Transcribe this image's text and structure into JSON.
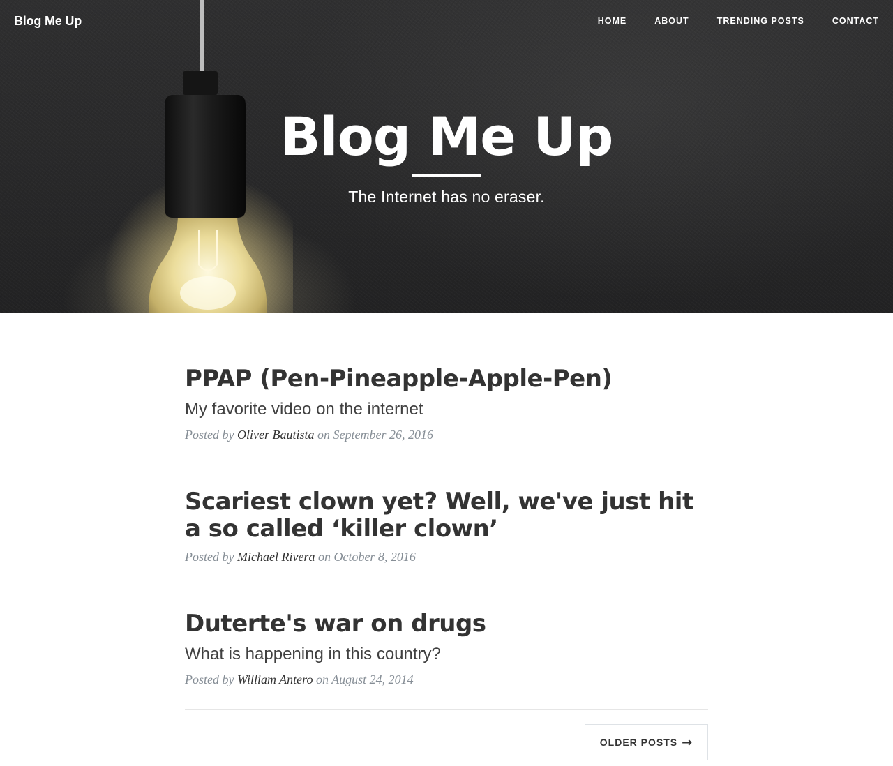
{
  "navbar": {
    "brand": "Blog Me Up",
    "links": [
      {
        "label": "HOME"
      },
      {
        "label": "ABOUT"
      },
      {
        "label": "TRENDING POSTS"
      },
      {
        "label": "CONTACT"
      }
    ]
  },
  "hero": {
    "title": "Blog Me Up",
    "subtitle": "The Internet has no eraser."
  },
  "posts": [
    {
      "title": "PPAP (Pen-Pineapple-Apple-Pen)",
      "subtitle": "My favorite video on the internet",
      "meta_prefix": "Posted by",
      "author": "Oliver Bautista",
      "date_text": "on September 26, 2016"
    },
    {
      "title": "Scariest clown yet? Well, we've just hit a so called ‘killer clown’",
      "meta_prefix": "Posted by",
      "author": "Michael Rivera",
      "date_text": "on October 8, 2016"
    },
    {
      "title": "Duterte's war on drugs",
      "subtitle": "What is happening in this country?",
      "meta_prefix": "Posted by",
      "author": "William Antero",
      "date_text": "on August 24, 2014"
    }
  ],
  "pager": {
    "older_label": "OLDER POSTS",
    "arrow": "→"
  },
  "icons": {
    "hero_image": "light-bulb",
    "pager_arrow": "arrow-right-icon"
  },
  "colors": {
    "text": "#333333",
    "meta": "#868e96",
    "divider": "#e6e6e6"
  }
}
